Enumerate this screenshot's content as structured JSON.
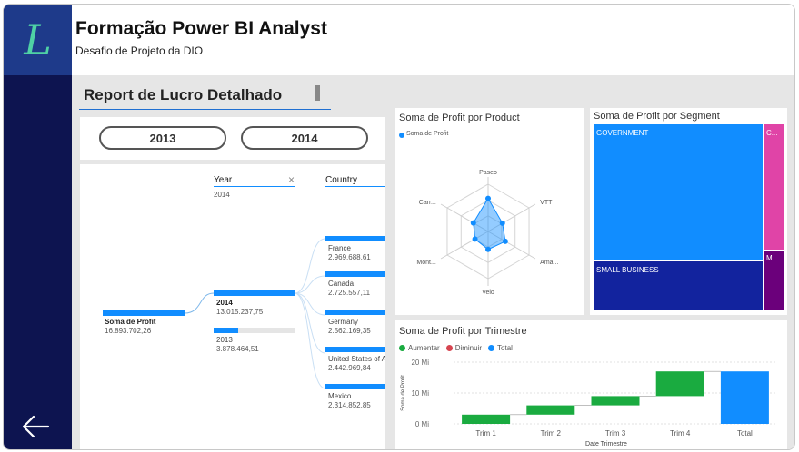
{
  "header": {
    "logo_letter": "L",
    "title": "Formação Power BI Analyst",
    "subtitle": "Desafio de Projeto da DIO"
  },
  "nav": {
    "back_icon": "arrow-left-icon"
  },
  "report": {
    "title": "Report de Lucro Detalhado"
  },
  "year_buttons": [
    "2013",
    "2014"
  ],
  "decomp_tree": {
    "col_year": {
      "label": "Year",
      "selected": "2014"
    },
    "col_country": {
      "label": "Country"
    },
    "root": {
      "label": "Soma de Profit",
      "value": "16.893.702,26"
    },
    "years": [
      {
        "label": "2014",
        "value": "13.015.237,75",
        "share": 0.77
      },
      {
        "label": "2013",
        "value": "3.878.464,51",
        "share": 0.23
      }
    ],
    "countries": [
      {
        "label": "France",
        "value": "2.969.688,61"
      },
      {
        "label": "Canada",
        "value": "2.725.557,11"
      },
      {
        "label": "Germany",
        "value": "2.562.169,35"
      },
      {
        "label": "United States of A",
        "value": "2.442.969,84"
      },
      {
        "label": "Mexico",
        "value": "2.314.852,85"
      }
    ]
  },
  "radar": {
    "title": "Soma de Profit por Product",
    "legend": "Soma de Profit",
    "axes": [
      "Paseo",
      "VTT",
      "Ama...",
      "Velo",
      "Mont...",
      "Carr..."
    ],
    "values": [
      0.7,
      0.35,
      0.42,
      0.38,
      0.32,
      0.36
    ],
    "color": "#118dff"
  },
  "treemap": {
    "title": "Soma de Profit por Segment",
    "tiles": [
      {
        "label": "GOVERNMENT",
        "color": "#118dff"
      },
      {
        "label": "SMALL BUSINESS",
        "color": "#12239e"
      },
      {
        "label": "C...",
        "color": "#e044a7"
      },
      {
        "label": "M...",
        "color": "#6b007b"
      }
    ]
  },
  "chart_data": {
    "type": "bar",
    "title": "Soma de Profit por Trimestre",
    "xlabel": "Date Trimestre",
    "ylabel": "Soma de Profit",
    "legend": [
      {
        "name": "Aumentar",
        "color": "#1aab40"
      },
      {
        "name": "Diminuir",
        "color": "#d64550"
      },
      {
        "name": "Total",
        "color": "#118dff"
      }
    ],
    "categories": [
      "Trim 1",
      "Trim 2",
      "Trim 3",
      "Trim 4",
      "Total"
    ],
    "series": [
      {
        "name": "Aumentar",
        "start": [
          0,
          3,
          6,
          9,
          0
        ],
        "end": [
          3,
          6,
          9,
          17,
          0
        ]
      },
      {
        "name": "Total",
        "values": [
          0,
          0,
          0,
          0,
          17
        ]
      }
    ],
    "yticks": [
      "0 Mi",
      "10 Mi",
      "20 Mi"
    ],
    "ylim": [
      0,
      20
    ],
    "grid": true
  }
}
